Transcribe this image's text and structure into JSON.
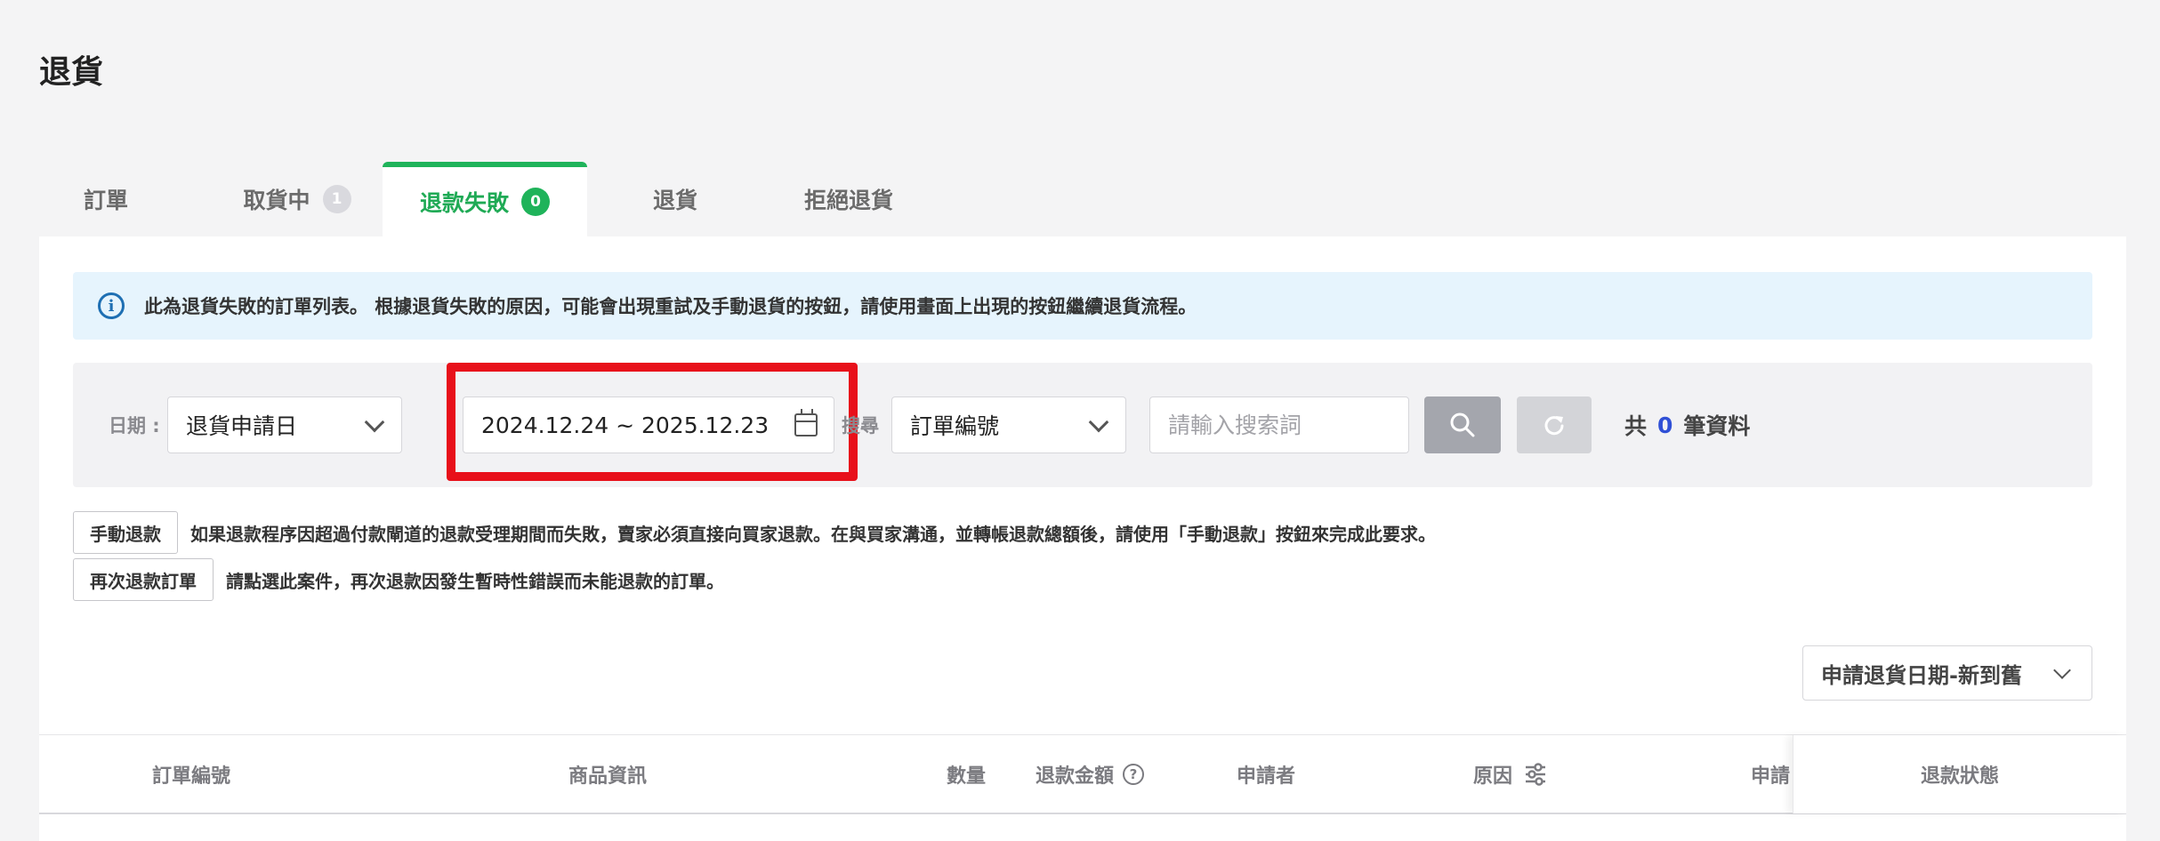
{
  "page": {
    "title": "退貨"
  },
  "tabs": [
    {
      "label": "訂單",
      "badge": ""
    },
    {
      "label": "取貨中",
      "badge": "1"
    },
    {
      "label": "退款失敗",
      "badge": "0"
    },
    {
      "label": "退貨",
      "badge": ""
    },
    {
      "label": "拒絕退貨",
      "badge": ""
    }
  ],
  "info": {
    "text": "此為退貨失敗的訂單列表。 根據退貨失敗的原因，可能會出現重試及手動退貨的按鈕，請使用畫面上出現的按鈕繼續退貨流程。"
  },
  "filters": {
    "date_label": "日期 :",
    "date_type": "退貨申請日",
    "date_range": "2024.12.24 ~ 2025.12.23",
    "search_label": "搜尋",
    "search_field": "訂單編號",
    "search_placeholder": "請輸入搜索詞",
    "count_prefix": "共",
    "count_value": "0",
    "count_suffix": "筆資料"
  },
  "actions": {
    "manual_refund": {
      "label": "手動退款",
      "desc": "如果退款程序因超過付款閘道的退款受理期間而失敗，賣家必須直接向買家退款。在與買家溝通，並轉帳退款總額後，請使用「手動退款」按鈕來完成此要求。"
    },
    "retry_refund": {
      "label": "再次退款訂單",
      "desc": "請點選此案件，再次退款因發生暫時性錯誤而未能退款的訂單。"
    }
  },
  "sort": {
    "selected": "申請退貨日期-新到舊"
  },
  "table": {
    "columns": {
      "order_no": "訂單編號",
      "product_info": "商品資訊",
      "quantity": "數量",
      "refund_amount": "退款金額",
      "applicant": "申請者",
      "reason": "原因",
      "apply_date": "申請日",
      "refund_status": "退款狀態"
    }
  },
  "colors": {
    "accent_green": "#1fb35a",
    "highlight_red": "#e8101a",
    "info_bg": "#e6f4fd",
    "count_blue": "#3050d6"
  }
}
